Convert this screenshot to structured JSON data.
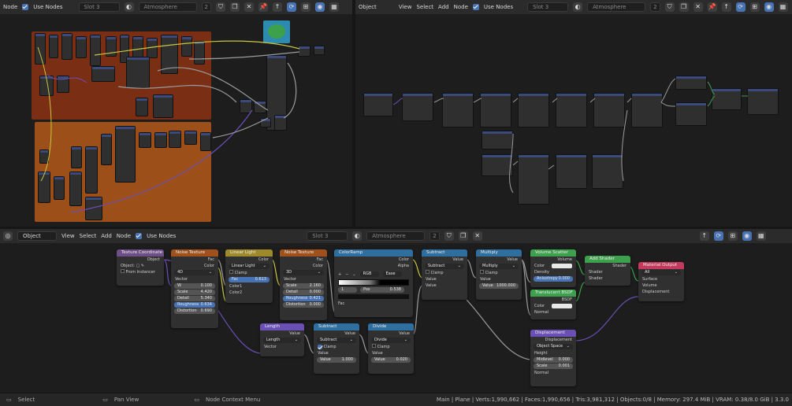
{
  "top_left_header": {
    "menu_node": "Node",
    "use_nodes": "Use Nodes",
    "slot": "Slot 3",
    "material": "Atmosphere",
    "users": "2"
  },
  "top_right_header": {
    "menu_object": "Object",
    "menu_view": "View",
    "menu_select": "Select",
    "menu_add": "Add",
    "menu_node": "Node",
    "use_nodes": "Use Nodes",
    "slot": "Slot 3",
    "material": "Atmosphere",
    "users": "2"
  },
  "bottom_header": {
    "mode": "Object",
    "menu_view": "View",
    "menu_select": "Select",
    "menu_add": "Add",
    "menu_node": "Node",
    "use_nodes": "Use Nodes",
    "slot": "Slot 3",
    "material": "Atmosphere",
    "users": "2"
  },
  "nodes": {
    "texcoord": {
      "title": "Texture Coordinate",
      "out_object": "Object",
      "object_label": "Object:",
      "from_instancer": "From Instancer"
    },
    "noise1": {
      "title": "Noise Texture",
      "out_fac": "Fac",
      "out_color": "Color",
      "dim": "4D",
      "vector": "Vector",
      "w_label": "W",
      "w_val": "0.100",
      "scale_label": "Scale",
      "scale_val": "4.420",
      "detail_label": "Detail",
      "detail_val": "5.340",
      "rough_label": "Roughness",
      "rough_val": "0.634",
      "distortion_label": "Distortion",
      "distortion_val": "0.690"
    },
    "mix": {
      "title": "Linear Light",
      "out_color": "Color",
      "blend": "Linear Light",
      "clamp": "Clamp",
      "fac_label": "Fac",
      "fac_val": "0.613",
      "color1": "Color1",
      "color2": "Color2"
    },
    "noise2": {
      "title": "Noise Texture",
      "out_fac": "Fac",
      "out_color": "Color",
      "dim": "3D",
      "vector": "Vector",
      "scale_label": "Scale",
      "scale_val": "2.160",
      "detail_label": "Detail",
      "detail_val": "0.000",
      "rough_label": "Roughness",
      "rough_val": "0.421",
      "distortion_label": "Distortion",
      "distortion_val": "0.000"
    },
    "ramp": {
      "title": "ColorRamp",
      "out_color": "Color",
      "out_alpha": "Alpha",
      "mode": "RGB",
      "interp": "Ease",
      "index": "1",
      "pos_label": "Pos",
      "pos_val": "0.538",
      "fac": "Fac"
    },
    "subtract1": {
      "title": "Subtract",
      "out_value": "Value",
      "op": "Subtract",
      "clamp": "Clamp",
      "value_a": "Value",
      "value_b": "Value"
    },
    "multiply": {
      "title": "Multiply",
      "out_value": "Value",
      "op": "Multiply",
      "clamp": "Clamp",
      "value_a": "Value",
      "value_b_label": "Value",
      "value_b_val": "1000.000"
    },
    "volscatter": {
      "title": "Volume Scatter",
      "out_volume": "Volume",
      "color": "Color",
      "density": "Density",
      "aniso_label": "Anisotropy",
      "aniso_val": "0.000"
    },
    "addshader": {
      "title": "Add Shader",
      "out_shader": "Shader",
      "in1": "Shader",
      "in2": "Shader"
    },
    "matout": {
      "title": "Material Output",
      "target": "All",
      "surface": "Surface",
      "volume": "Volume",
      "displacement": "Displacement"
    },
    "translucent": {
      "title": "Translucent BSDF",
      "out_bsdf": "BSDF",
      "color": "Color",
      "normal": "Normal"
    },
    "length": {
      "title": "Length",
      "out_value": "Value",
      "op": "Length",
      "vector": "Vector"
    },
    "subtract2": {
      "title": "Subtract",
      "out_value": "Value",
      "op": "Subtract",
      "clamp": "Clamp",
      "value_a": "Value",
      "value_b_label": "Value",
      "value_b_val": "1.000"
    },
    "divide": {
      "title": "Divide",
      "out_value": "Value",
      "op": "Divide",
      "clamp": "Clamp",
      "value_a": "Value",
      "value_b_label": "Value",
      "value_b_val": "0.020"
    },
    "displacement": {
      "title": "Displacement",
      "out_disp": "Displacement",
      "space": "Object Space",
      "height": "Height",
      "mid_label": "Midlevel",
      "mid_val": "0.000",
      "scale_label": "Scale",
      "scale_val": "0.001",
      "normal": "Normal"
    }
  },
  "status_bar": {
    "select": "Select",
    "pan": "Pan View",
    "context": "Node Context Menu",
    "stats": "Main | Plane | Verts:1,990,662 | Faces:1,990,656 | Tris:3,981,312 | Objects:0/8 | Memory: 297.4 MiB | VRAM: 0.38/8.0 GiB | 3.3.0"
  },
  "colors": {
    "bg": "#1d1d1d",
    "header": "#2b2b2b",
    "input": "#6e4e86",
    "texture": "#d2691e",
    "converter": "#2f6fa0",
    "shader": "#3ca04d",
    "output": "#c33a5c",
    "vector": "#6a4fb4",
    "color_mix": "#b0a040",
    "frame_red": "#7a2e14",
    "frame_orange": "#9c4f18"
  }
}
